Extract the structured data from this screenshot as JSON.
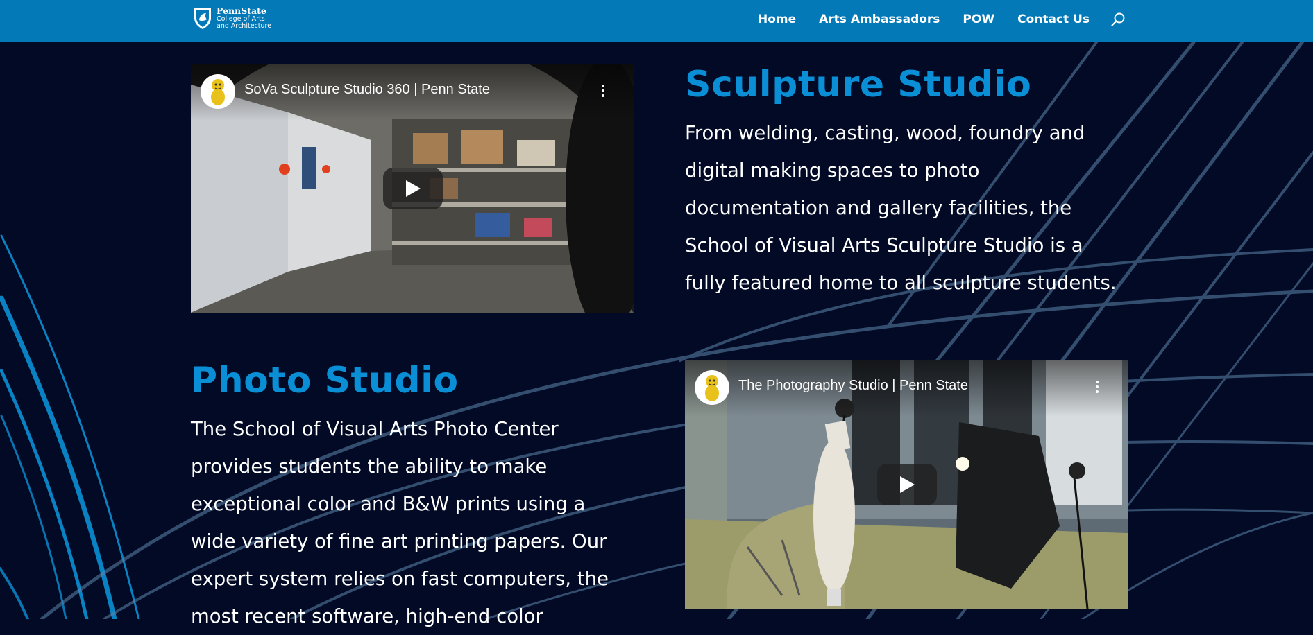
{
  "header": {
    "logo": {
      "title": "PennState",
      "line1": "College of Arts",
      "line2": "and Architecture"
    },
    "nav": [
      "Home",
      "Arts Ambassadors",
      "POW",
      "Contact Us"
    ]
  },
  "sculpture": {
    "heading": "Sculpture Studio",
    "body_lines": [
      "From welding, casting, wood, foundry and",
      "digital making spaces to photo",
      "documentation and gallery facilities, the",
      "School of Visual Arts Sculpture Studio is a",
      "fully featured home to all sculpture students."
    ],
    "video_title": "SoVa Sculpture Studio 360 | Penn State"
  },
  "photo": {
    "heading": "Photo Studio",
    "body_lines": [
      "The School of Visual Arts Photo Center",
      "provides students the ability to make",
      "exceptional color and B&W prints using a",
      "wide variety of fine art printing papers. Our",
      "expert system relies on fast computers, the",
      "most recent software, high-end color"
    ],
    "video_title": "The Photography Studio | Penn State"
  },
  "colors": {
    "header_bg": "#0479b8",
    "page_bg": "#020a25",
    "heading": "#0a8fd6",
    "background_lines": "#0a8fd6"
  },
  "icons": [
    "penn-state-shield-icon",
    "search-icon",
    "more-vertical-icon",
    "play-icon",
    "nittany-lion-avatar-icon"
  ]
}
